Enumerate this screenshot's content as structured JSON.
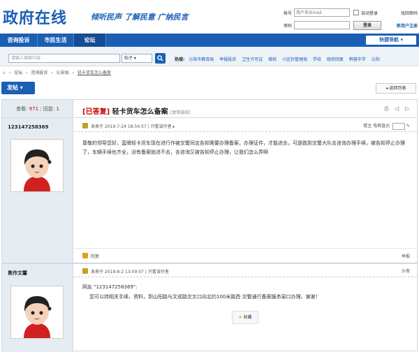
{
  "header": {
    "logo": "政府在线",
    "slogan": "倾听民声 了解民意 广纳民言",
    "login": {
      "account_label": "帐号",
      "account_placeholder": "用户名/Email",
      "auto_login": "自动登录",
      "find_password": "找回密码",
      "password_label": "密码",
      "login_button": "登录",
      "register": "新用户注册"
    }
  },
  "nav": {
    "items": [
      "咨询投诉",
      "市民生活",
      "论坛"
    ],
    "quick_nav": "快捷导航 ▾"
  },
  "search": {
    "placeholder": "请输入搜索内容",
    "select": "帖子 ▾",
    "hot_label": "热搜:",
    "hot_items": [
      "沁阳市教育局",
      "举报投诉",
      "卫生许可证",
      "维权",
      "小区封管理局",
      "学校",
      "政府回复",
      "韩营中学",
      "沁阳"
    ]
  },
  "breadcrumb": [
    "⌂",
    "›",
    "论坛",
    "›",
    "咨询投诉",
    "›",
    "沁安局",
    "›",
    "轻卡货车怎么备案"
  ],
  "post_button": "发帖 ▾",
  "back_button": "◂ 返回列表",
  "thread": {
    "views_label": "查看:",
    "views": "971",
    "replies_label": "回复:",
    "replies": "1",
    "title_tag": "[已答复]",
    "title": "轻卡货车怎么备案",
    "copy_link": "[复制链接]",
    "icons": "⎙ ◁ ▷"
  },
  "posts": [
    {
      "author": "123147258369",
      "posted": "发表于 2019-7-24 18:54:57 | 只看该作者 ▸",
      "right": "楼主   电梯直达",
      "body": "尊敬的领导您好，蓝牌轻卡货车现在进行作被交警同志告知需要办理备案，办理证件，才能进去，可是跑到交警大队去咨询办理手续，被告知停止办理了，车辆手续也齐全，没有备案就进不去，去咨询又被告知停止办理，让我们怎么弄啊",
      "fav": "收藏",
      "reply": "回复",
      "report": "举报"
    },
    {
      "author": "焦作文馨",
      "posted": "发表于 2019-8-2 13:09:07 | 只看该作者",
      "right": "沙发",
      "reply_to": "网友 \"123147258369\":",
      "body": "您可以持相关手续、资料，到山阳路与文成路交叉口向北约100米路西 交警通行备案服务窗口办理。谢谢！"
    }
  ]
}
